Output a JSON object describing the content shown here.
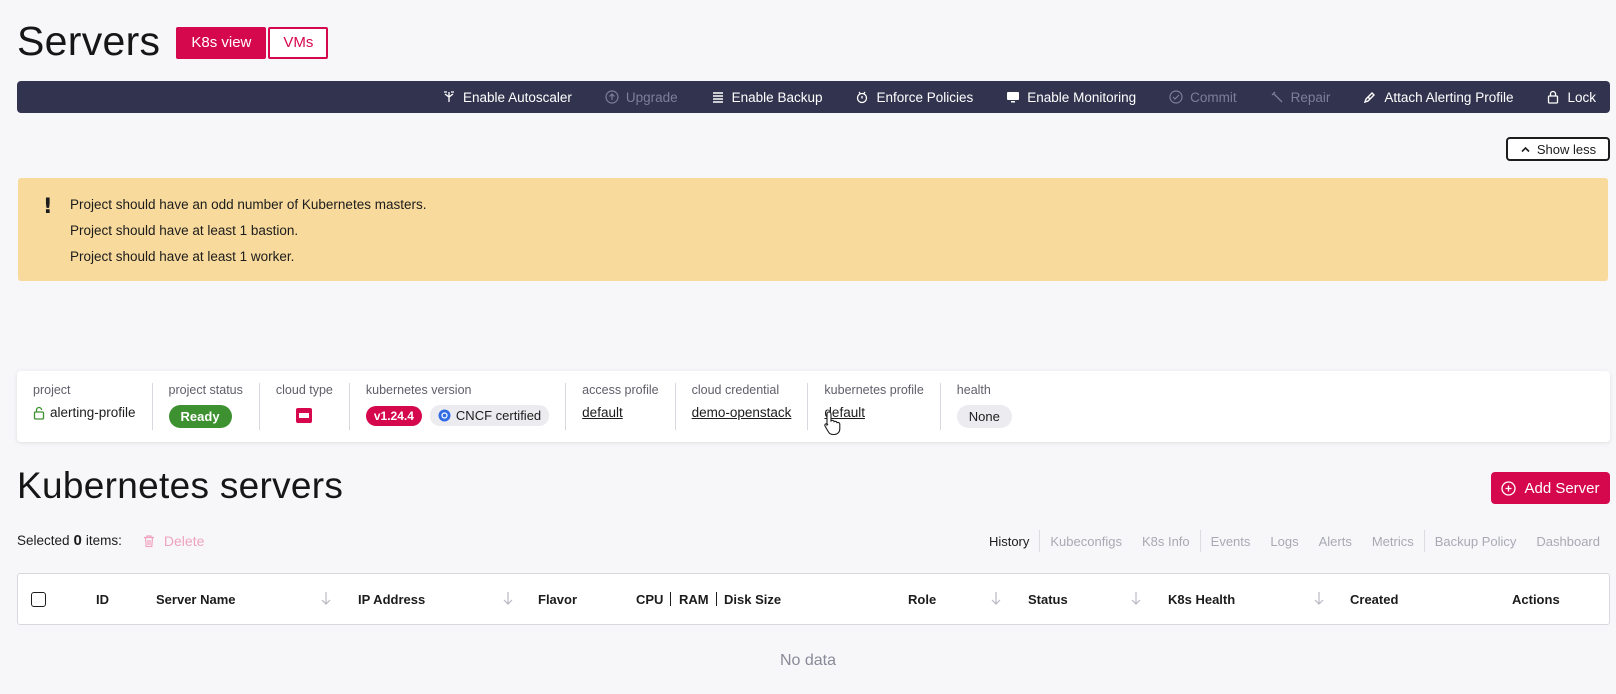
{
  "page": {
    "title": "Servers"
  },
  "view_switch": {
    "active": "K8s view",
    "inactive": "VMs"
  },
  "toolbar": {
    "items": [
      {
        "label": "Enable Autoscaler",
        "icon": "autoscaler-icon",
        "disabled": false
      },
      {
        "label": "Upgrade",
        "icon": "upgrade-icon",
        "disabled": true
      },
      {
        "label": "Enable Backup",
        "icon": "backup-icon",
        "disabled": false
      },
      {
        "label": "Enforce Policies",
        "icon": "policy-icon",
        "disabled": false
      },
      {
        "label": "Enable Monitoring",
        "icon": "monitor-icon",
        "disabled": false
      },
      {
        "label": "Commit",
        "icon": "commit-icon",
        "disabled": true
      },
      {
        "label": "Repair",
        "icon": "repair-icon",
        "disabled": true
      },
      {
        "label": "Attach Alerting Profile",
        "icon": "attach-icon",
        "disabled": false
      },
      {
        "label": "Lock",
        "icon": "lock-icon",
        "disabled": false
      }
    ]
  },
  "show_less": {
    "label": "Show less"
  },
  "warnings": {
    "icon": "!",
    "messages": [
      "Project should have an odd number of Kubernetes masters.",
      "Project should have at least 1 bastion.",
      "Project should have at least 1 worker."
    ]
  },
  "project_info": {
    "project": {
      "label": "project",
      "value": "alerting-profile"
    },
    "status": {
      "label": "project status",
      "value": "Ready"
    },
    "cloud_type": {
      "label": "cloud type"
    },
    "k8s_version": {
      "label": "kubernetes version",
      "version": "v1.24.4",
      "cert": "CNCF certified"
    },
    "access_profile": {
      "label": "access profile",
      "value": "default"
    },
    "cloud_credential": {
      "label": "cloud credential",
      "value": "demo-openstack"
    },
    "k8s_profile": {
      "label": "kubernetes profile",
      "value": "default"
    },
    "health": {
      "label": "health",
      "value": "None"
    }
  },
  "servers": {
    "title": "Kubernetes servers",
    "add_button": "Add Server",
    "selected_prefix": "Selected",
    "selected_count": "0",
    "selected_suffix": "items:",
    "delete_label": "Delete",
    "tabs": [
      "History",
      "Kubeconfigs",
      "K8s Info",
      "Events",
      "Logs",
      "Alerts",
      "Metrics",
      "Backup Policy",
      "Dashboard"
    ],
    "columns": {
      "id": "ID",
      "name": "Server Name",
      "ip": "IP Address",
      "flavor": "Flavor",
      "cpu": "CPU",
      "ram": "RAM",
      "disk": "Disk Size",
      "role": "Role",
      "status": "Status",
      "health": "K8s Health",
      "created": "Created",
      "actions": "Actions"
    },
    "empty": "No data"
  },
  "colors": {
    "brand": "#d6084d",
    "toolbar_bg": "#32344f",
    "warning_bg": "#f8da9c",
    "ready": "#3d9130"
  }
}
